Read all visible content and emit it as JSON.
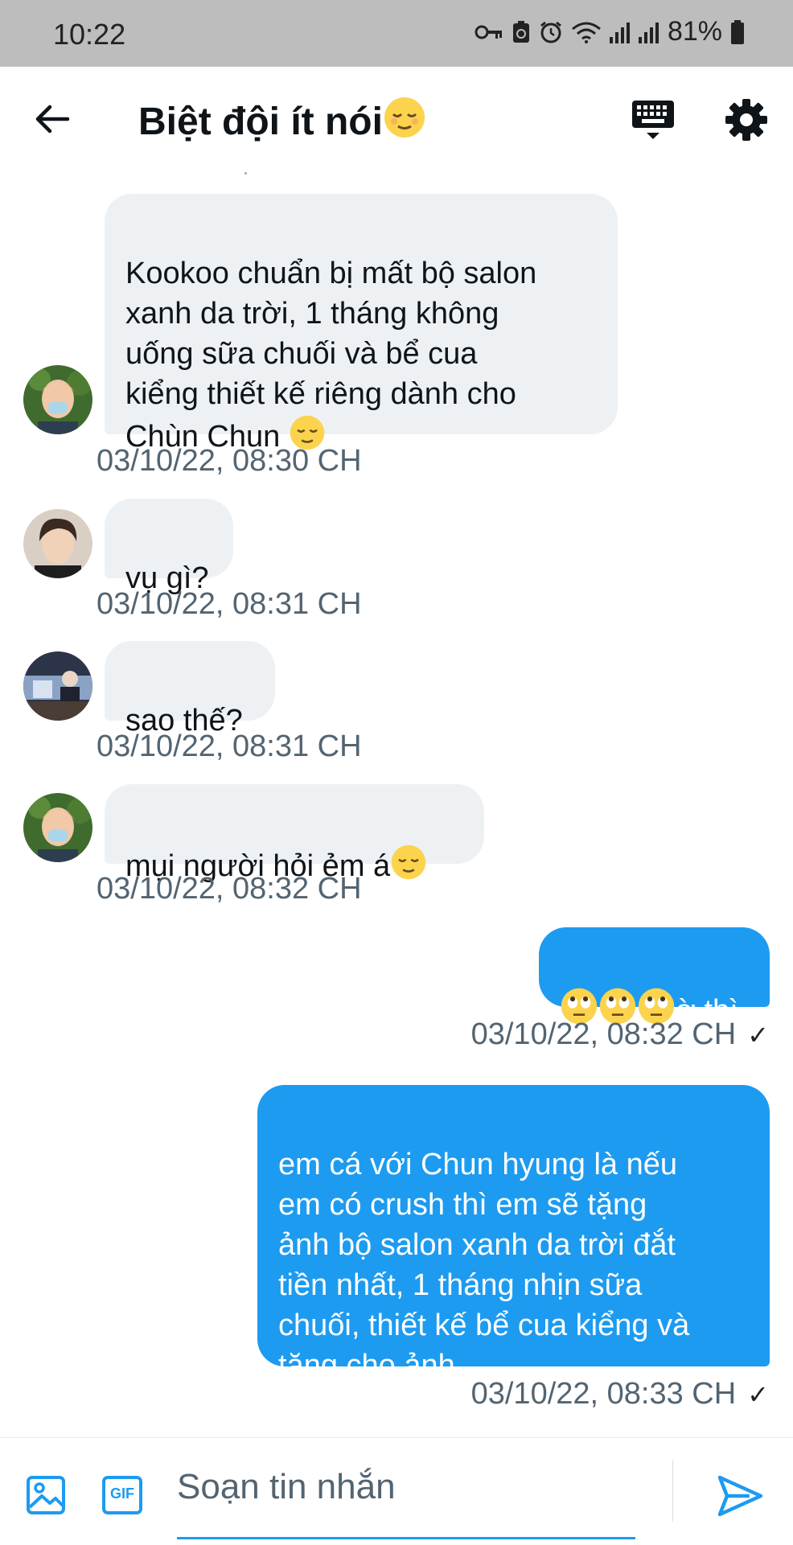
{
  "status_bar": {
    "time": "10:22",
    "battery": "81%"
  },
  "header": {
    "title": "Biệt đội ít nói"
  },
  "messages": [
    {
      "direction": "incoming",
      "text": "Kookoo chuẩn bị mất bộ salon\nxanh da trời, 1 tháng không\nuống sữa chuối và bể cua\nkiểng thiết kế riêng dành cho\nChùn Chun ",
      "timestamp": "03/10/22, 08:30 CH"
    },
    {
      "direction": "incoming",
      "text": "vụ gì?",
      "timestamp": "03/10/22, 08:31 CH"
    },
    {
      "direction": "incoming",
      "text": "sao thế?",
      "timestamp": "03/10/22, 08:31 CH"
    },
    {
      "direction": "incoming",
      "text": "mụi người hỏi ẻm á",
      "timestamp": "03/10/22, 08:32 CH"
    },
    {
      "direction": "outgoing",
      "text": "ờ thì",
      "timestamp": "03/10/22, 08:32 CH",
      "read": "✓"
    },
    {
      "direction": "outgoing",
      "text": "em cá với Chun hyung là nếu\nem có crush thì em sẽ tặng\nảnh bộ salon xanh da trời đắt\ntiền nhất, 1 tháng nhịn sữa\nchuối, thiết kế bể cua kiểng và\ntặng cho ảnh",
      "timestamp": "03/10/22, 08:33 CH",
      "read": "✓"
    }
  ],
  "composer": {
    "placeholder": "Soạn tin nhắn",
    "gif_label": "GIF"
  },
  "colors": {
    "accent": "#1d9bf0",
    "incoming_bubble": "#eef1f4",
    "timestamp": "#536471",
    "status_bar": "#bdbdbd"
  },
  "icons": {
    "back": "arrow-left-icon",
    "keyboard": "keyboard-icon",
    "settings": "gear-icon",
    "image": "image-icon",
    "gif": "gif-icon",
    "send": "send-icon",
    "emoji": "relieved-face-emoji / eye-roll-face-emoji"
  }
}
